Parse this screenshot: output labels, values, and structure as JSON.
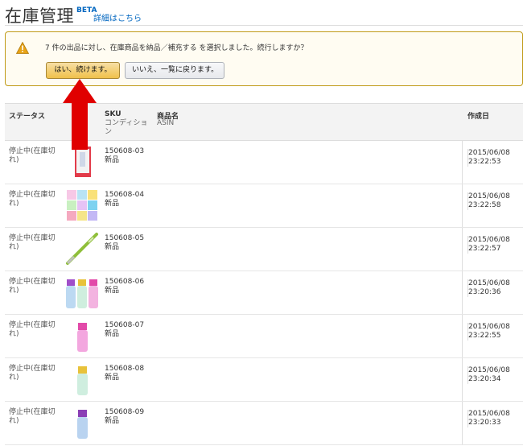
{
  "header": {
    "title": "在庫管理",
    "beta": "BETA",
    "details_link": "詳細はこちら"
  },
  "alert": {
    "icon": "warning-icon",
    "message": "7 件の出品に対し、在庫商品を納品／補充する を選択しました。続行しますか？",
    "yes_label": "はい、続けます。",
    "no_label": "いいえ、一覧に戻ります。"
  },
  "table": {
    "headers": {
      "status": "ステータス",
      "sku": "SKU",
      "condition": "コンディション",
      "product_name": "商品名",
      "asin": "ASIN",
      "created": "作成日"
    },
    "rows": [
      {
        "status": "停止中(在庫切れ)",
        "sku": "150608-03",
        "condition": "新品",
        "date": "2015/06/08",
        "time": "23:22:53",
        "image": "product-card-icon"
      },
      {
        "status": "停止中(在庫切れ)",
        "sku": "150608-04",
        "condition": "新品",
        "date": "2015/06/08",
        "time": "23:22:58",
        "image": "sticker-sheet-icon"
      },
      {
        "status": "停止中(在庫切れ)",
        "sku": "150608-05",
        "condition": "新品",
        "date": "2015/06/08",
        "time": "23:22:57",
        "image": "pen-icon"
      },
      {
        "status": "停止中(在庫切れ)",
        "sku": "150608-06",
        "condition": "新品",
        "date": "2015/06/08",
        "time": "23:20:36",
        "image": "bottle-set-icon"
      },
      {
        "status": "停止中(在庫切れ)",
        "sku": "150608-07",
        "condition": "新品",
        "date": "2015/06/08",
        "time": "23:22:55",
        "image": "pink-bottle-icon"
      },
      {
        "status": "停止中(在庫切れ)",
        "sku": "150608-08",
        "condition": "新品",
        "date": "2015/06/08",
        "time": "23:20:34",
        "image": "yellow-bottle-icon"
      },
      {
        "status": "停止中(在庫切れ)",
        "sku": "150608-09",
        "condition": "新品",
        "date": "2015/06/08",
        "time": "23:20:33",
        "image": "purple-bottle-icon"
      }
    ]
  },
  "colors": {
    "link": "#0066c0",
    "alert_border": "#c09a17",
    "primary_button": "#f0c14b",
    "arrow": "#e00000"
  }
}
